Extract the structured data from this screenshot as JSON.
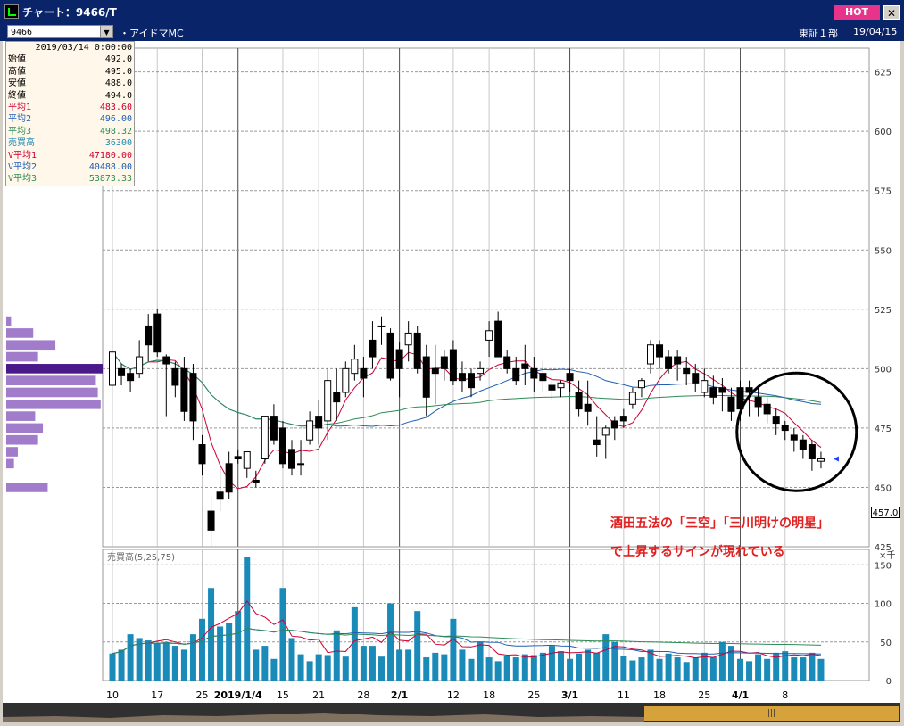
{
  "window": {
    "title": "チャート：9466/T",
    "hot_label": "HOT",
    "close_glyph": "✕"
  },
  "header": {
    "code": "9466",
    "dropdown_glyph": "▼",
    "name": "・アイドマMC",
    "market": "東証１部",
    "date": "19/04/15"
  },
  "ohlc_panel": {
    "datetime": "2019/03/14 0:00:00",
    "rows": [
      {
        "label": "始値",
        "value": "492.0",
        "color": "#000000"
      },
      {
        "label": "高値",
        "value": "495.0",
        "color": "#000000"
      },
      {
        "label": "安値",
        "value": "488.0",
        "color": "#000000"
      },
      {
        "label": "終値",
        "value": "494.0",
        "color": "#000000"
      },
      {
        "label": "平均1",
        "value": "483.60",
        "color": "#cc0033"
      },
      {
        "label": "平均2",
        "value": "496.00",
        "color": "#1f5fb4"
      },
      {
        "label": "平均3",
        "value": "498.32",
        "color": "#2e8b57"
      },
      {
        "label": "売買高",
        "value": "36300",
        "color": "#1a8ab8"
      },
      {
        "label": "V平均1",
        "value": "47180.00",
        "color": "#cc0033"
      },
      {
        "label": "V平均2",
        "value": "40488.00",
        "color": "#1f5fb4"
      },
      {
        "label": "V平均3",
        "value": "53873.33",
        "color": "#2e8b57"
      }
    ]
  },
  "volume_panel": {
    "title": "売買高(5,25,75)",
    "unit": "×千"
  },
  "last_price_marker": "457.0",
  "annotation": {
    "line1": "酒田五法の「三空」「三川明けの明星」",
    "line2": "で上昇するサインが現れている",
    "color": "#e02020"
  },
  "scrollbar": {
    "thumb_label": "|||"
  },
  "chart_data": {
    "type": "candlestick",
    "price_axis": {
      "ylim": [
        425,
        635
      ],
      "ticks": [
        425,
        450,
        475,
        500,
        525,
        550,
        575,
        600,
        625
      ]
    },
    "volume_axis": {
      "ylim": [
        0,
        170
      ],
      "ticks": [
        0,
        50,
        100,
        150
      ],
      "unit": "×千"
    },
    "x_labels": [
      {
        "label": "10",
        "i": 0
      },
      {
        "label": "17",
        "i": 5
      },
      {
        "label": "25",
        "i": 10
      },
      {
        "label": "2019/1/4",
        "i": 14
      },
      {
        "label": "15",
        "i": 19
      },
      {
        "label": "21",
        "i": 23
      },
      {
        "label": "28",
        "i": 28
      },
      {
        "label": "2/1",
        "i": 32
      },
      {
        "label": "12",
        "i": 38
      },
      {
        "label": "18",
        "i": 42
      },
      {
        "label": "25",
        "i": 47
      },
      {
        "label": "3/1",
        "i": 51
      },
      {
        "label": "11",
        "i": 57
      },
      {
        "label": "18",
        "i": 61
      },
      {
        "label": "25",
        "i": 66
      },
      {
        "label": "4/1",
        "i": 70
      },
      {
        "label": "8",
        "i": 75
      }
    ],
    "month_separators": [
      14,
      32,
      51,
      70
    ],
    "candles": [
      [
        493,
        507,
        498,
        507
      ],
      [
        500,
        502,
        493,
        497
      ],
      [
        498,
        500,
        490,
        495
      ],
      [
        498,
        512,
        496,
        505
      ],
      [
        518,
        523,
        503,
        510
      ],
      [
        523,
        525,
        505,
        507
      ],
      [
        505,
        506,
        480,
        502
      ],
      [
        500,
        503,
        488,
        493
      ],
      [
        500,
        505,
        478,
        482
      ],
      [
        498,
        502,
        470,
        478
      ],
      [
        468,
        472,
        455,
        460
      ],
      [
        440,
        446,
        425,
        432
      ],
      [
        448,
        460,
        440,
        445
      ],
      [
        460,
        465,
        445,
        448
      ],
      [
        463,
        466,
        460,
        462
      ],
      [
        458,
        465,
        454,
        465
      ],
      [
        453,
        457,
        450,
        452
      ],
      [
        462,
        480,
        460,
        480
      ],
      [
        480,
        485,
        468,
        470
      ],
      [
        475,
        478,
        458,
        460
      ],
      [
        466,
        470,
        455,
        458
      ],
      [
        460,
        470,
        455,
        460
      ],
      [
        470,
        482,
        468,
        478
      ],
      [
        480,
        487,
        468,
        475
      ],
      [
        478,
        500,
        470,
        495
      ],
      [
        490,
        500,
        478,
        486
      ],
      [
        490,
        503,
        488,
        500
      ],
      [
        498,
        510,
        495,
        504
      ],
      [
        500,
        505,
        488,
        496
      ],
      [
        512,
        520,
        500,
        505
      ],
      [
        518,
        522,
        510,
        518
      ],
      [
        515,
        517,
        495,
        496
      ],
      [
        508,
        511,
        488,
        500
      ],
      [
        510,
        520,
        503,
        515
      ],
      [
        515,
        518,
        498,
        500
      ],
      [
        505,
        510,
        480,
        488
      ],
      [
        500,
        510,
        485,
        498
      ],
      [
        505,
        508,
        495,
        500
      ],
      [
        508,
        512,
        493,
        495
      ],
      [
        498,
        503,
        490,
        495
      ],
      [
        498,
        500,
        488,
        492
      ],
      [
        498,
        503,
        495,
        500
      ],
      [
        512,
        520,
        505,
        516
      ],
      [
        520,
        524,
        505,
        505
      ],
      [
        505,
        508,
        498,
        500
      ],
      [
        500,
        505,
        493,
        495
      ],
      [
        502,
        510,
        493,
        500
      ],
      [
        500,
        505,
        490,
        496
      ],
      [
        498,
        503,
        490,
        495
      ],
      [
        493,
        497,
        487,
        491
      ],
      [
        492,
        495,
        488,
        494
      ],
      [
        498,
        500,
        490,
        495
      ],
      [
        490,
        495,
        480,
        483
      ],
      [
        485,
        495,
        476,
        482
      ],
      [
        470,
        480,
        463,
        468
      ],
      [
        472,
        476,
        462,
        475
      ],
      [
        478,
        480,
        470,
        475
      ],
      [
        480,
        483,
        475,
        478
      ],
      [
        485,
        492,
        483,
        490
      ],
      [
        492,
        496,
        488,
        495
      ],
      [
        502,
        512,
        498,
        510
      ],
      [
        510,
        512,
        500,
        505
      ],
      [
        505,
        508,
        498,
        500
      ],
      [
        505,
        508,
        495,
        502
      ],
      [
        500,
        505,
        493,
        498
      ],
      [
        498,
        502,
        490,
        494
      ],
      [
        490,
        500,
        488,
        495
      ],
      [
        492,
        497,
        485,
        488
      ],
      [
        492,
        496,
        482,
        490
      ],
      [
        488,
        492,
        478,
        482
      ],
      [
        492,
        495,
        478,
        483
      ],
      [
        492,
        495,
        480,
        490
      ],
      [
        488,
        492,
        480,
        484
      ],
      [
        485,
        488,
        477,
        481
      ],
      [
        480,
        483,
        472,
        477
      ],
      [
        476,
        478,
        470,
        474
      ],
      [
        472,
        475,
        465,
        470
      ],
      [
        470,
        472,
        462,
        466
      ],
      [
        468,
        470,
        457,
        462
      ],
      [
        461,
        465,
        458,
        462
      ]
    ],
    "volumes": [
      35,
      40,
      60,
      55,
      52,
      48,
      50,
      45,
      40,
      60,
      80,
      120,
      70,
      75,
      90,
      160,
      40,
      45,
      28,
      120,
      55,
      34,
      25,
      34,
      33,
      65,
      31,
      95,
      45,
      45,
      31,
      100,
      40,
      40,
      90,
      30,
      36,
      34,
      80,
      40,
      28,
      50,
      30,
      25,
      32,
      30,
      34,
      33,
      36,
      45,
      38,
      28,
      35,
      40,
      36,
      60,
      50,
      32,
      26,
      30,
      40,
      28,
      35,
      30,
      24,
      30,
      36,
      30,
      50,
      45,
      28,
      25,
      34,
      28,
      36,
      38,
      30,
      30,
      36,
      28
    ],
    "series": [
      {
        "name": "平均1",
        "kind": "price_ma",
        "period": 5,
        "color": "#cc0033"
      },
      {
        "name": "平均2",
        "kind": "price_ma",
        "period": 25,
        "color": "#1f5fb4"
      },
      {
        "name": "平均3",
        "kind": "price_ma",
        "period": 75,
        "color": "#2e8b57"
      },
      {
        "name": "V平均1",
        "kind": "volume_ma",
        "period": 5,
        "color": "#cc0033"
      },
      {
        "name": "V平均2",
        "kind": "volume_ma",
        "period": 25,
        "color": "#1f5fb4"
      },
      {
        "name": "V平均3",
        "kind": "volume_ma",
        "period": 75,
        "color": "#2e8b57"
      }
    ],
    "volume_profile": [
      {
        "price": 520,
        "relative": 0.05
      },
      {
        "price": 515,
        "relative": 0.28
      },
      {
        "price": 510,
        "relative": 0.51
      },
      {
        "price": 505,
        "relative": 0.33
      },
      {
        "price": 500,
        "relative": 1.0
      },
      {
        "price": 495,
        "relative": 0.93
      },
      {
        "price": 490,
        "relative": 0.95
      },
      {
        "price": 485,
        "relative": 0.98
      },
      {
        "price": 480,
        "relative": 0.3
      },
      {
        "price": 475,
        "relative": 0.38
      },
      {
        "price": 470,
        "relative": 0.33
      },
      {
        "price": 465,
        "relative": 0.12
      },
      {
        "price": 460,
        "relative": 0.08
      },
      {
        "price": 450,
        "relative": 0.43
      }
    ],
    "highlight": {
      "from": 72,
      "to": 79,
      "shape": "circle",
      "color": "#000000"
    }
  }
}
